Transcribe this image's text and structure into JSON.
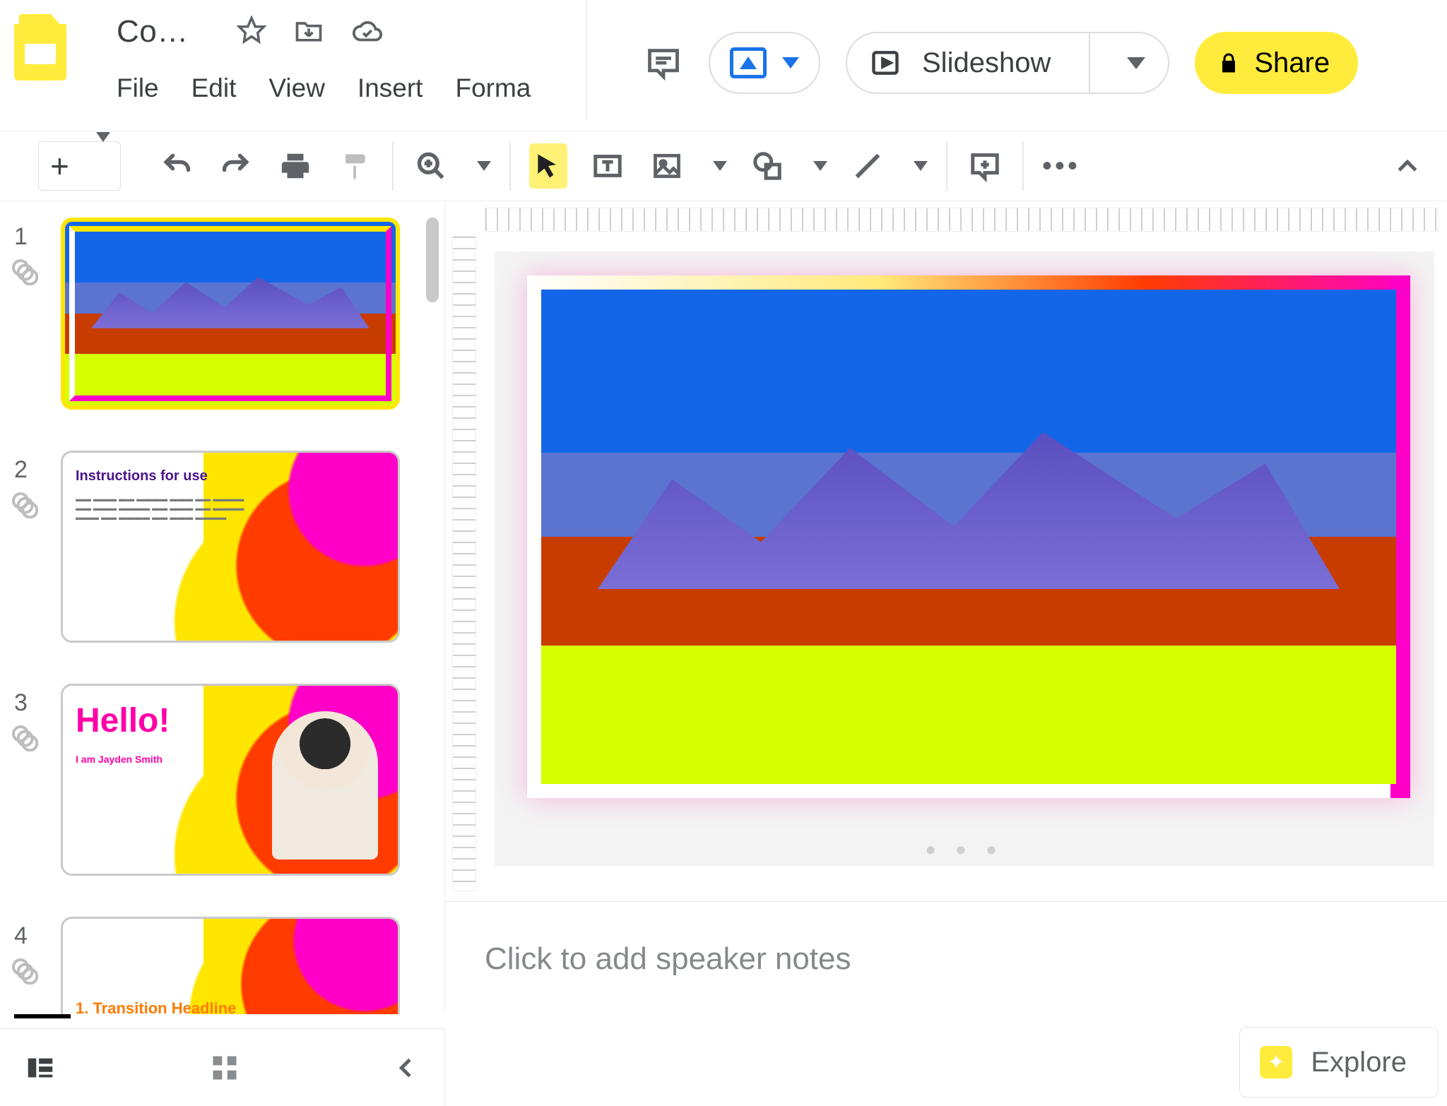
{
  "header": {
    "doc_title": "Co…",
    "menu": {
      "file": "File",
      "edit": "Edit",
      "view": "View",
      "insert": "Insert",
      "format": "Forma"
    }
  },
  "app_actions": {
    "slideshow_label": "Slideshow",
    "share_label": "Share"
  },
  "toolbar_icons": {
    "new_slide": "new-slide",
    "undo": "undo",
    "redo": "redo",
    "print": "print",
    "paint": "paint-format",
    "zoom": "zoom",
    "select": "select",
    "textbox": "text-box",
    "image": "image",
    "shape": "shape",
    "line": "line",
    "comment": "add-comment",
    "more": "more"
  },
  "filmstrip": {
    "slides": [
      {
        "n": "1",
        "selected": true,
        "kind": "mountain"
      },
      {
        "n": "2",
        "selected": false,
        "kind": "instructions",
        "title": "Instructions for use"
      },
      {
        "n": "3",
        "selected": false,
        "kind": "hello",
        "title": "Hello!",
        "sub": "I am Jayden Smith"
      },
      {
        "n": "4",
        "selected": false,
        "kind": "transition",
        "title": "1. Transition Headline"
      }
    ]
  },
  "notes": {
    "placeholder": "Click to add speaker notes"
  },
  "explore": {
    "label": "Explore"
  },
  "pager": "● ● ●"
}
